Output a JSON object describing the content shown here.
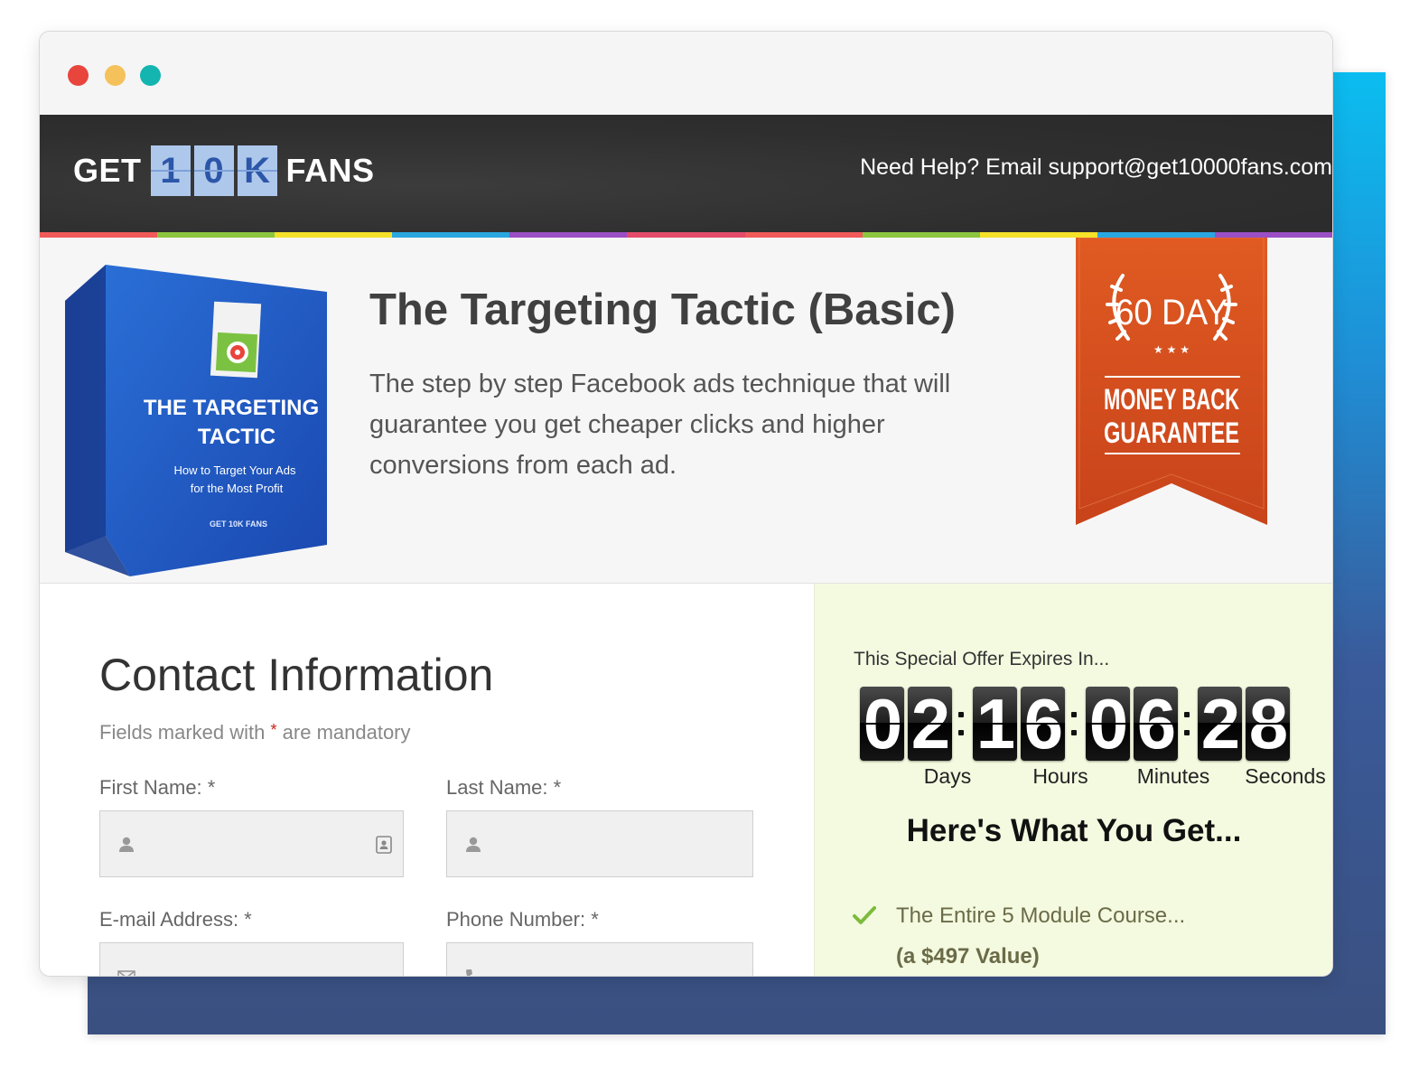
{
  "logo": {
    "word1": "GET",
    "digits": [
      "1",
      "0",
      "K"
    ],
    "word2": "FANS"
  },
  "header": {
    "help_text": "Need Help? Email support@get10000fans.com"
  },
  "stripe_colors": [
    "#f05a5a",
    "#8cc63e",
    "#f5e12a",
    "#2aa7e0",
    "#9b4fc4",
    "#e44a6a",
    "#f05a5a",
    "#8cc63e",
    "#f5e12a",
    "#2aa7e0",
    "#9b4fc4"
  ],
  "product": {
    "title": "The Targeting Tactic (Basic)",
    "description": "The step by step Facebook ads technique that will guarantee you get cheaper clicks and higher conversions from each ad.",
    "box": {
      "title_line1": "THE TARGETING",
      "title_line2": "TACTIC",
      "subtitle_line1": "How to Target Your Ads",
      "subtitle_line2": "for the Most Profit",
      "brand": "GET 10K FANS"
    }
  },
  "guarantee": {
    "days": "60 DAY",
    "stars": "★ ★ ★",
    "line1": "MONEY BACK",
    "line2": "GUARANTEE"
  },
  "contact": {
    "title": "Contact Information",
    "mandatory_pre": "Fields marked with",
    "mandatory_star": "*",
    "mandatory_post": "are mandatory",
    "fields": [
      {
        "label": "First Name: *",
        "icon": "user-icon",
        "value": ""
      },
      {
        "label": "Last Name: *",
        "icon": "user-icon",
        "value": ""
      },
      {
        "label": "E-mail Address: *",
        "icon": "envelope-icon",
        "value": ""
      },
      {
        "label": "Phone Number: *",
        "icon": "phone-icon",
        "value": ""
      }
    ]
  },
  "offer": {
    "expires_text": "This Special Offer Expires In...",
    "countdown": [
      {
        "value": "02",
        "label": "Days"
      },
      {
        "value": "16",
        "label": "Hours"
      },
      {
        "value": "06",
        "label": "Minutes"
      },
      {
        "value": "28",
        "label": "Seconds"
      }
    ],
    "heading": "Here's What You Get...",
    "benefit": "The Entire 5 Module Course...",
    "benefit_value": "(a $497 Value)",
    "check_color": "#7dbb3c"
  }
}
